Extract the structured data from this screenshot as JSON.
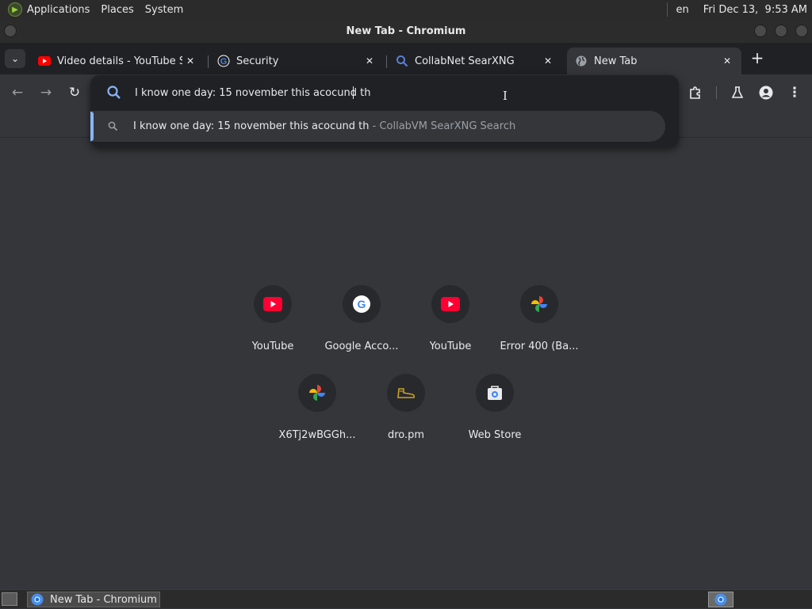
{
  "top_panel": {
    "menus": [
      "Applications",
      "Places",
      "System"
    ],
    "keyboard_layout": "en",
    "clock": "Fri Dec 13,  9:53 AM"
  },
  "window": {
    "title": "New Tab - Chromium"
  },
  "tabs": [
    {
      "title": "Video details - YouTube Studio",
      "icon": "youtube-icon",
      "close": "✕"
    },
    {
      "title": "Security",
      "icon": "google-icon",
      "close": "✕"
    },
    {
      "title": "CollabNet SearXNG",
      "icon": "search-icon",
      "close": "✕"
    },
    {
      "title": "New Tab",
      "icon": "globe-icon",
      "close": "✕",
      "active": true
    }
  ],
  "tab_search_glyph": "⌄",
  "new_tab_glyph": "+",
  "toolbar": {
    "back_glyph": "←",
    "forward_glyph": "→",
    "reload_glyph": "↻",
    "menu_glyph": "⋮"
  },
  "omnibox": {
    "value": "I know one day: 15 november this acocund th",
    "suggestion": {
      "text": "I know one day: 15 november this acocund th",
      "source": " - CollabVM SearXNG Search"
    }
  },
  "shortcuts": [
    {
      "label": "YouTube",
      "icon": "youtube-icon"
    },
    {
      "label": "Google Acco...",
      "icon": "google-icon"
    },
    {
      "label": "YouTube",
      "icon": "youtube-icon"
    },
    {
      "label": "Error 400 (Ba...",
      "icon": "photos-icon"
    },
    {
      "label": "X6Tj2wBGGh...",
      "icon": "photos-icon"
    },
    {
      "label": "dro.pm",
      "icon": "shoe-icon"
    },
    {
      "label": "Web Store",
      "icon": "web-store-icon"
    }
  ],
  "taskbar": {
    "task_title": "New Tab - Chromium"
  },
  "colors": {
    "accent": "#8ab4f8",
    "youtube_red": "#ff0000",
    "bg": "#35363a",
    "tabstrip": "#202124"
  }
}
